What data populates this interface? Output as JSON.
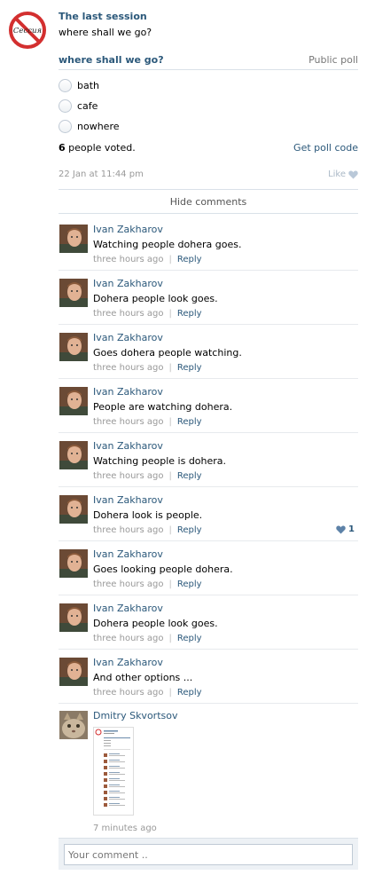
{
  "post": {
    "author": "The last session",
    "avatar_label": "Сессия",
    "text": "where shall we go?",
    "date": "22 Jan at 11:44 pm",
    "like_label": "Like"
  },
  "poll": {
    "title": "where shall we go?",
    "type": "Public poll",
    "options": [
      "bath",
      "cafe",
      "nowhere"
    ],
    "votes_count": "6",
    "votes_suffix": " people voted.",
    "get_code": "Get poll code"
  },
  "comments_toggle": "Hide comments",
  "comments": [
    {
      "author": "Ivan Zakharov",
      "text": "Watching people dohera goes.",
      "time": "three hours ago",
      "reply": "Reply",
      "likes": ""
    },
    {
      "author": "Ivan Zakharov",
      "text": "Dohera people look goes.",
      "time": "three hours ago",
      "reply": "Reply",
      "likes": ""
    },
    {
      "author": "Ivan Zakharov",
      "text": "Goes dohera people watching.",
      "time": "three hours ago",
      "reply": "Reply",
      "likes": ""
    },
    {
      "author": "Ivan Zakharov",
      "text": "People are watching dohera.",
      "time": "three hours ago",
      "reply": "Reply",
      "likes": ""
    },
    {
      "author": "Ivan Zakharov",
      "text": "Watching people is dohera.",
      "time": "three hours ago",
      "reply": "Reply",
      "likes": ""
    },
    {
      "author": "Ivan Zakharov",
      "text": "Dohera look is people.",
      "time": "three hours ago",
      "reply": "Reply",
      "likes": "1"
    },
    {
      "author": "Ivan Zakharov",
      "text": "Goes looking people dohera.",
      "time": "three hours ago",
      "reply": "Reply",
      "likes": ""
    },
    {
      "author": "Ivan Zakharov",
      "text": "Dohera people look goes.",
      "time": "three hours ago",
      "reply": "Reply",
      "likes": ""
    },
    {
      "author": "Ivan Zakharov",
      "text": "And other options ...",
      "time": "three hours ago",
      "reply": "Reply",
      "likes": ""
    }
  ],
  "last_comment": {
    "author": "Dmitry Skvortsov",
    "time": "7 minutes ago"
  },
  "reply_box": {
    "placeholder": "Your comment .."
  },
  "colors": {
    "link": "#2b587a",
    "muted": "#999999",
    "border": "#dae1e8",
    "stop_sign": "#d32f2f"
  }
}
